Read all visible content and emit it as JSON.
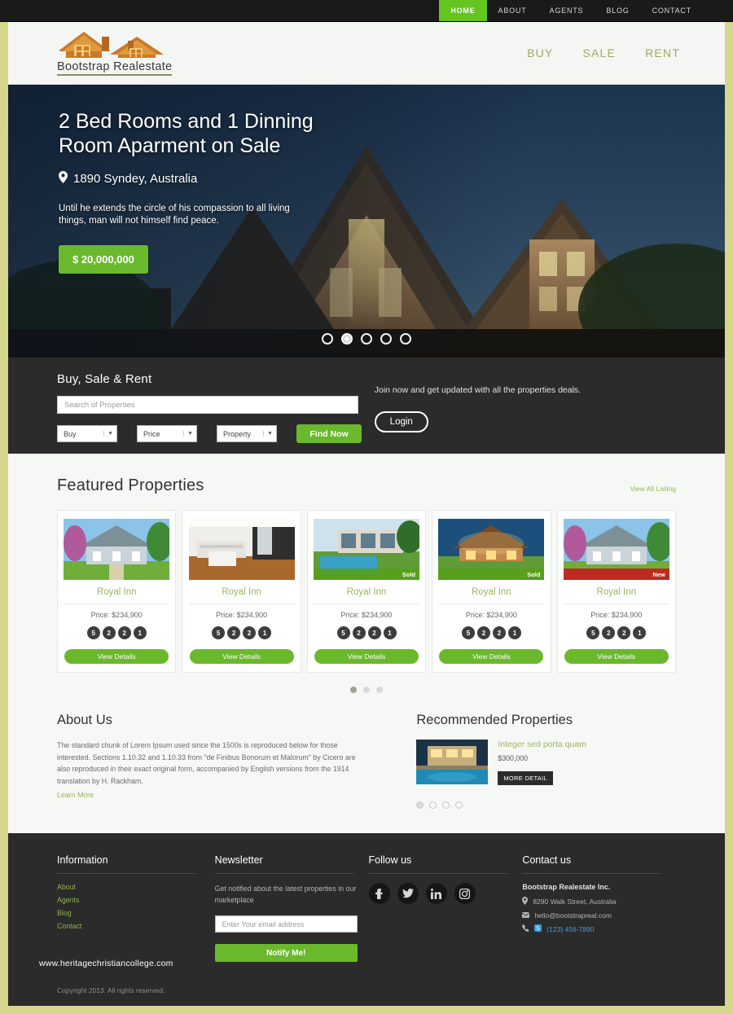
{
  "topnav": {
    "items": [
      {
        "label": "HOME",
        "active": true
      },
      {
        "label": "ABOUT",
        "active": false
      },
      {
        "label": "AGENTS",
        "active": false
      },
      {
        "label": "BLOG",
        "active": false
      },
      {
        "label": "CONTACT",
        "active": false
      }
    ]
  },
  "header": {
    "logo_text": "Bootstrap Realestate",
    "nav": [
      {
        "label": "BUY"
      },
      {
        "label": "SALE"
      },
      {
        "label": "RENT"
      }
    ]
  },
  "hero": {
    "title": "2 Bed Rooms and 1 Dinning Room Aparment on Sale",
    "location": "1890 Syndey, Australia",
    "description": "Until he extends the circle of his compassion to all living things, man will not himself find peace.",
    "price": "$ 20,000,000",
    "dots": 5,
    "active_dot": 1
  },
  "search": {
    "title": "Buy, Sale & Rent",
    "placeholder": "Search of Properties",
    "input_value": "",
    "selects": [
      {
        "value": "Buy"
      },
      {
        "value": "Price"
      },
      {
        "value": "Property"
      }
    ],
    "find_label": "Find Now",
    "join_text": "Join now and get updated with all the properties deals.",
    "login_label": "Login"
  },
  "featured": {
    "title": "Featured Properties",
    "view_all": "View All Listing",
    "cards": [
      {
        "name": "Royal Inn",
        "price": "Price: $234,900",
        "badges": [
          "5",
          "2",
          "2",
          "1"
        ],
        "button": "View Details",
        "ribbon": "",
        "ribbon_type": ""
      },
      {
        "name": "Royal Inn",
        "price": "Price: $234,900",
        "badges": [
          "5",
          "2",
          "2",
          "1"
        ],
        "button": "View Details",
        "ribbon": "",
        "ribbon_type": ""
      },
      {
        "name": "Royal Inn",
        "price": "Price: $234,900",
        "badges": [
          "5",
          "2",
          "2",
          "1"
        ],
        "button": "View Details",
        "ribbon": "Sold",
        "ribbon_type": "sold"
      },
      {
        "name": "Royal Inn",
        "price": "Price: $234,900",
        "badges": [
          "5",
          "2",
          "2",
          "1"
        ],
        "button": "View Details",
        "ribbon": "Sold",
        "ribbon_type": "sold"
      },
      {
        "name": "Royal Inn",
        "price": "Price: $234,900",
        "badges": [
          "5",
          "2",
          "2",
          "1"
        ],
        "button": "View Details",
        "ribbon": "New",
        "ribbon_type": "new"
      }
    ],
    "dots": 3,
    "active_dot": 0
  },
  "about": {
    "title": "About Us",
    "text": "The standard chunk of Lorem Ipsum used since the 1500s is reproduced below for those interested. Sections 1.10.32 and 1.10.33 from \"de Finibus Bonorum et Malorum\" by Cicero are also reproduced in their exact original form, accompanied by English versions from the 1914 translation by H. Rackham.",
    "learn_more": "Learn More"
  },
  "recommended": {
    "title": "Recommended Properties",
    "item_name": "Integer sed porta quam",
    "item_price": "$300,000",
    "item_button": "MORE DETAIL",
    "dots": 4,
    "active_dot": 0
  },
  "footer": {
    "information": {
      "title": "Information",
      "links": [
        {
          "label": "About"
        },
        {
          "label": "Agents"
        },
        {
          "label": "Blog"
        },
        {
          "label": "Contact"
        }
      ]
    },
    "newsletter": {
      "title": "Newsletter",
      "text": "Get notified about the latest properties in our marketplace",
      "placeholder": "Enter Your email address",
      "input_value": "",
      "button": "Notify Me!"
    },
    "follow": {
      "title": "Follow us",
      "socials": [
        {
          "name": "facebook",
          "glyph": "f"
        },
        {
          "name": "twitter",
          "glyph": "t"
        },
        {
          "name": "linkedin",
          "glyph": "in"
        },
        {
          "name": "instagram",
          "glyph": "ig"
        }
      ]
    },
    "contact": {
      "title": "Contact us",
      "company": "Bootstrap Realestate Inc.",
      "address": "8290 Walk Street, Australia",
      "email": "hello@bootstrapreal.com",
      "phone": "(123) 456-7890"
    },
    "watermark": "www.heritagechristiancollege.com",
    "copyright": "Copyright 2013. All rights reserved."
  },
  "colors": {
    "accent_green": "#6ab92c",
    "olive": "#9ab463",
    "dark": "#2b2b2b",
    "frame": "#d6d68f",
    "sold": "#56a018",
    "new": "#c81a1a",
    "phone_blue": "#3aa0dd"
  }
}
